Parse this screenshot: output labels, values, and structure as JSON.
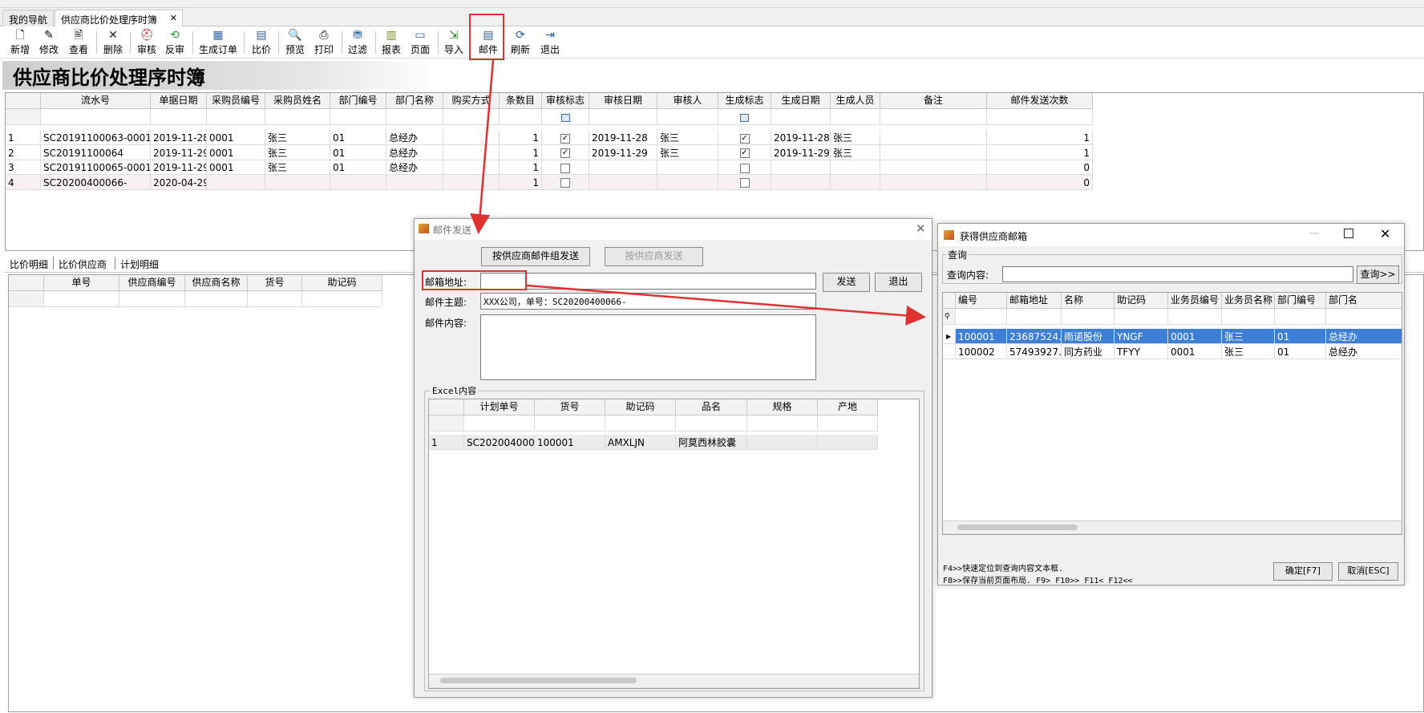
{
  "tabs": {
    "nav": "我的导航",
    "current": "供应商比价处理序时簿",
    "close": "✕"
  },
  "toolbar": [
    {
      "label": "新增",
      "icon": "new-icon",
      "glyph": "🗋"
    },
    {
      "label": "修改",
      "icon": "edit-icon",
      "glyph": "✎"
    },
    {
      "label": "查看",
      "icon": "view-icon",
      "glyph": "🖹"
    },
    {
      "label": "删除",
      "icon": "delete-icon",
      "glyph": "✕"
    },
    {
      "label": "审核",
      "icon": "audit-icon",
      "glyph": "⛑"
    },
    {
      "label": "反审",
      "icon": "unaudit-icon",
      "glyph": "⟲"
    },
    {
      "label": "生成订单",
      "icon": "generate-order-icon",
      "glyph": "▦"
    },
    {
      "label": "比价",
      "icon": "compare-icon",
      "glyph": "▤"
    },
    {
      "label": "预览",
      "icon": "preview-icon",
      "glyph": "🔍"
    },
    {
      "label": "打印",
      "icon": "print-icon",
      "glyph": "⎙"
    },
    {
      "label": "过滤",
      "icon": "filter-icon",
      "glyph": "⛃"
    },
    {
      "label": "报表",
      "icon": "report-icon",
      "glyph": "▥"
    },
    {
      "label": "页面",
      "icon": "page-icon",
      "glyph": "▭"
    },
    {
      "label": "导入",
      "icon": "import-icon",
      "glyph": "⇲"
    },
    {
      "label": "邮件",
      "icon": "mail-icon",
      "glyph": "▤"
    },
    {
      "label": "刷新",
      "icon": "refresh-icon",
      "glyph": "⟳"
    },
    {
      "label": "退出",
      "icon": "exit-icon",
      "glyph": "⇥"
    }
  ],
  "page_title": "供应商比价处理序时簿",
  "main_grid": {
    "columns": [
      "流水号",
      "单据日期",
      "采购员编号",
      "采购员姓名",
      "部门编号",
      "部门名称",
      "购买方式",
      "条数目",
      "审核标志",
      "审核日期",
      "审核人",
      "生成标志",
      "生成日期",
      "生成人员",
      "备注",
      "邮件发送次数"
    ],
    "rows": [
      {
        "idx": "1",
        "no": "SC20191100063-0001",
        "date": "2019-11-28",
        "buyer_no": "0001",
        "buyer": "张三",
        "dept_no": "01",
        "dept": "总经办",
        "method": "",
        "count": "1",
        "audit": "✓",
        "audit_date": "2019-11-28",
        "auditor": "张三",
        "gen": "✓",
        "gen_date": "2019-11-28",
        "gen_by": "张三",
        "note": "",
        "mail": "1"
      },
      {
        "idx": "2",
        "no": "SC20191100064",
        "date": "2019-11-29",
        "buyer_no": "0001",
        "buyer": "张三",
        "dept_no": "01",
        "dept": "总经办",
        "method": "",
        "count": "1",
        "audit": "✓",
        "audit_date": "2019-11-29",
        "auditor": "张三",
        "gen": "✓",
        "gen_date": "2019-11-29",
        "gen_by": "张三",
        "note": "",
        "mail": "1"
      },
      {
        "idx": "3",
        "no": "SC20191100065-0001",
        "date": "2019-11-29",
        "buyer_no": "0001",
        "buyer": "张三",
        "dept_no": "01",
        "dept": "总经办",
        "method": "",
        "count": "1",
        "audit": "",
        "audit_date": "",
        "auditor": "",
        "gen": "",
        "gen_date": "",
        "gen_by": "",
        "note": "",
        "mail": "0"
      },
      {
        "idx": "4",
        "no": "SC20200400066-",
        "date": "2020-04-29",
        "buyer_no": "",
        "buyer": "",
        "dept_no": "",
        "dept": "",
        "method": "",
        "count": "1",
        "audit": "",
        "audit_date": "",
        "auditor": "",
        "gen": "",
        "gen_date": "",
        "gen_by": "",
        "note": "",
        "mail": "0"
      }
    ]
  },
  "detail_tabs": [
    "比价明细",
    "比价供应商",
    "计划明细"
  ],
  "detail_grid": {
    "columns": [
      "单号",
      "供应商编号",
      "供应商名称",
      "货号",
      "助记码"
    ]
  },
  "mail_dialog": {
    "title": "邮件发送",
    "btn_group_send": "按供应商邮件组发送",
    "btn_supplier_send": "按供应商发送",
    "email_label": "邮箱地址:",
    "email_value": "",
    "send": "发送",
    "exit": "退出",
    "subject_label": "邮件主题:",
    "subject_value": "XXX公司，单号：SC20200400066-",
    "content_label": "邮件内容:",
    "excel_group": "Excel内容",
    "excel_columns": [
      "计划单号",
      "货号",
      "助记码",
      "品名",
      "规格",
      "产地"
    ],
    "excel_rows": [
      {
        "idx": "1",
        "plan_no": "SC202004000...",
        "item_no": "100001",
        "code": "AMXLJN",
        "name": "阿莫西林胶囊",
        "spec": "",
        "origin": ""
      }
    ]
  },
  "supplier_dialog": {
    "title": "获得供应商邮箱",
    "group": "查询",
    "query_label": "查询内容:",
    "query_value": "",
    "query_btn": "查询>>",
    "columns": [
      "编号",
      "邮箱地址",
      "名称",
      "助记码",
      "业务员编号",
      "业务员名称",
      "部门编号",
      "部门名"
    ],
    "rows": [
      {
        "id": "100001",
        "email": "23687524...",
        "name": "雨诺股份",
        "code": "YNGF",
        "sales_no": "0001",
        "sales": "张三",
        "dept_no": "01",
        "dept": "总经办"
      },
      {
        "id": "100002",
        "email": "57493927...",
        "name": "同方药业",
        "code": "TFYY",
        "sales_no": "0001",
        "sales": "张三",
        "dept_no": "01",
        "dept": "总经办"
      }
    ],
    "hint1": "F4>>快速定位到查询内容文本框.",
    "hint2": "F8>>保存当前页面布局.  F9> F10>> F11< F12<<",
    "ok": "确定[F7]",
    "cancel": "取消[ESC]"
  },
  "colors": {
    "accent_red": "#e03030",
    "selection": "#3d7fd6"
  }
}
